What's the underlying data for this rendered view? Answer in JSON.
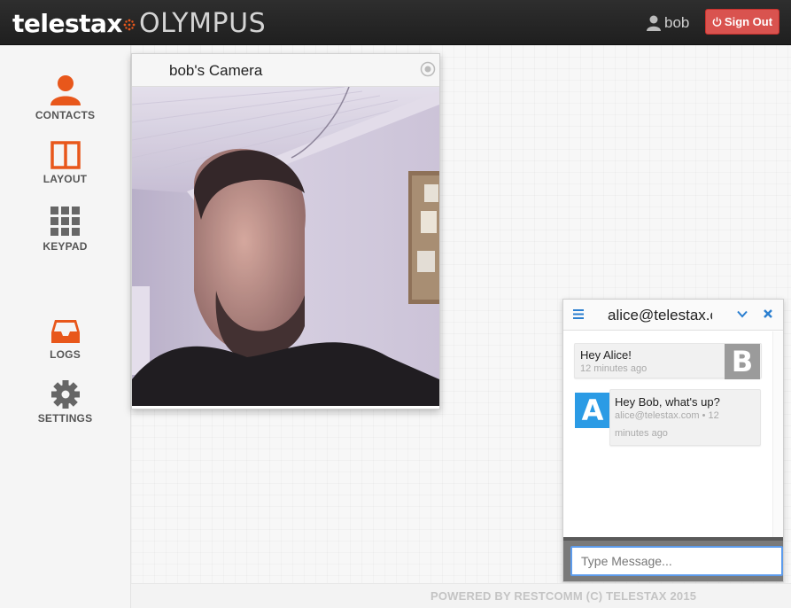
{
  "header": {
    "brand_left": "telestax",
    "brand_right": "OLYMPUS",
    "username": "bob",
    "signout_label": "Sign Out"
  },
  "sidebar": {
    "items": [
      {
        "label": "CONTACTS",
        "icon": "person-icon",
        "color": "#e8571b"
      },
      {
        "label": "LAYOUT",
        "icon": "layout-icon",
        "color": "#e8571b"
      },
      {
        "label": "KEYPAD",
        "icon": "keypad-icon",
        "color": "#666666"
      },
      {
        "label": "LOGS",
        "icon": "inbox-icon",
        "color": "#e8571b"
      },
      {
        "label": "SETTINGS",
        "icon": "gear-icon",
        "color": "#666666"
      }
    ]
  },
  "camera": {
    "title": "bob's Camera"
  },
  "chat": {
    "title": "alice@telestax.c",
    "messages": [
      {
        "text": "Hey Alice!",
        "meta": "12 minutes ago",
        "avatar": "B",
        "avatar_color": "#9b9b9b",
        "side": "right"
      },
      {
        "text": "Hey Bob, what's up?",
        "meta_line1": "alice@telestax.com • 12",
        "meta_line2": "minutes ago",
        "avatar": "A",
        "avatar_color": "#2b9be5",
        "side": "left"
      }
    ],
    "input_placeholder": "Type Message..."
  },
  "footer": {
    "text": "POWERED BY RESTCOMM (C) TELESTAX 2015"
  },
  "colors": {
    "accent": "#e8571b",
    "signout": "#d9534f",
    "chat_blue": "#2b7fd0"
  }
}
